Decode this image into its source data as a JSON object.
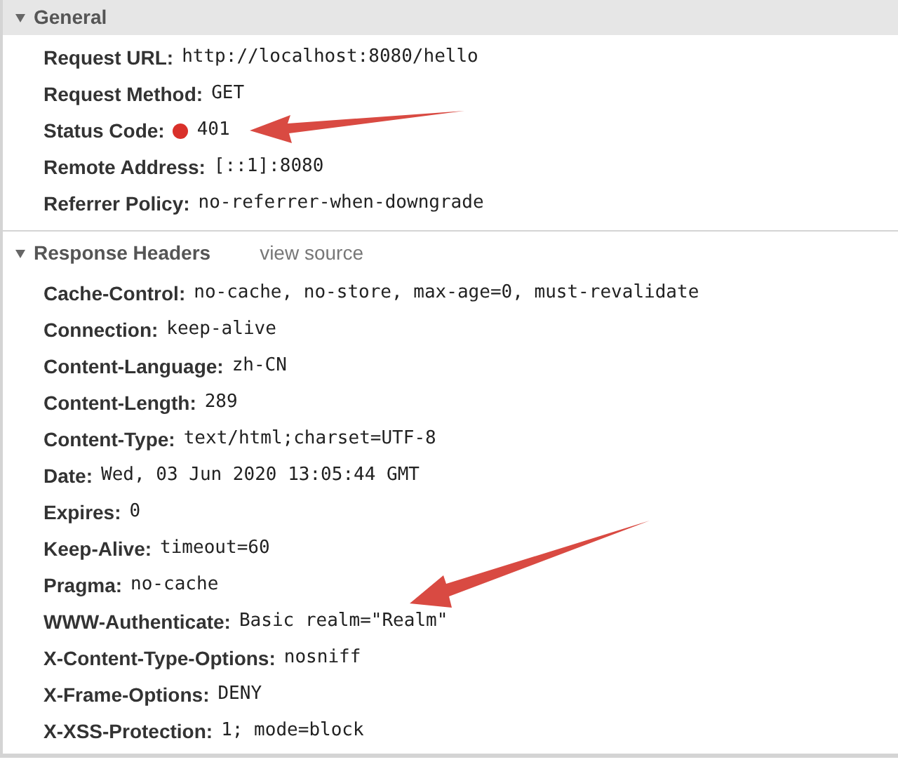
{
  "sections": [
    {
      "title": "General",
      "expanded": true,
      "rows": [
        {
          "name": "Request URL:",
          "value": "http://localhost:8080/hello"
        },
        {
          "name": "Request Method:",
          "value": "GET"
        },
        {
          "name": "Status Code:",
          "value": "401",
          "color": "#d9302a"
        },
        {
          "name": "Remote Address:",
          "value": "[::1]:8080"
        },
        {
          "name": "Referrer Policy:",
          "value": "no-referrer-when-downgrade"
        }
      ]
    },
    {
      "title": "Response Headers",
      "expanded": true,
      "link": "view source",
      "rows": [
        {
          "name": "Cache-Control:",
          "value": "no-cache, no-store, max-age=0, must-revalidate"
        },
        {
          "name": "Connection:",
          "value": "keep-alive"
        },
        {
          "name": "Content-Language:",
          "value": "zh-CN"
        },
        {
          "name": "Content-Length:",
          "value": "289"
        },
        {
          "name": "Content-Type:",
          "value": "text/html;charset=UTF-8"
        },
        {
          "name": "Date:",
          "value": "Wed, 03 Jun 2020 13:05:44 GMT"
        },
        {
          "name": "Expires:",
          "value": "0"
        },
        {
          "name": "Keep-Alive:",
          "value": "timeout=60"
        },
        {
          "name": "Pragma:",
          "value": "no-cache"
        },
        {
          "name": "WWW-Authenticate:",
          "value": "Basic realm=\"Realm\""
        },
        {
          "name": "X-Content-Type-Options:",
          "value": "nosniff"
        },
        {
          "name": "X-Frame-Options:",
          "value": "DENY"
        },
        {
          "name": "X-XSS-Protection:",
          "value": "1; mode=block"
        }
      ]
    }
  ]
}
